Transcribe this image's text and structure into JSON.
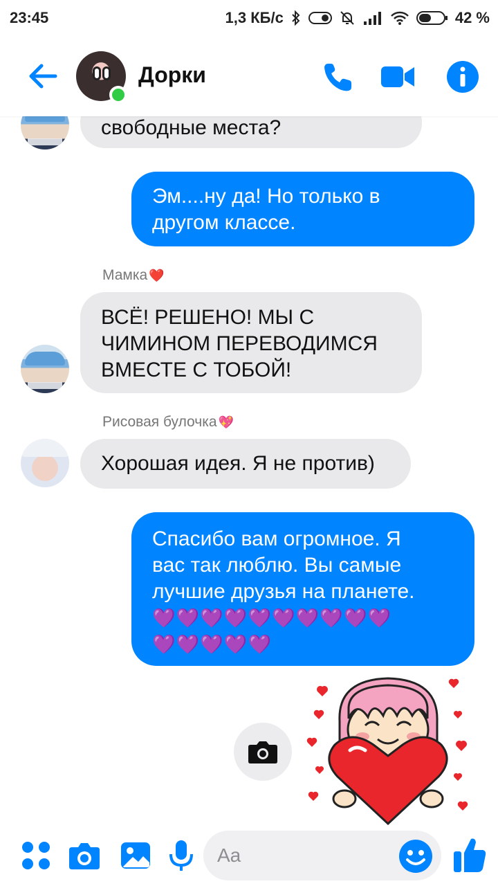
{
  "status": {
    "time": "23:45",
    "network_speed": "1,3 КБ/с",
    "battery": "42 %"
  },
  "header": {
    "contact_name": "Дорки"
  },
  "messages": [
    {
      "side": "in",
      "text": "свободные места?"
    },
    {
      "side": "out",
      "lines": [
        "Эм....ну да! Но только в",
        "другом классе."
      ]
    },
    {
      "sender": "Мамка",
      "sender_emoji": "❤️",
      "side": "in",
      "lines": [
        "ВСЁ! РЕШЕНО! МЫ С",
        "ЧИМИНОМ ПЕРЕВОДИМСЯ",
        "ВМЕСТЕ С ТОБОЙ!"
      ]
    },
    {
      "sender": "Рисовая булочка",
      "sender_emoji": "💖",
      "side": "in",
      "text": "Хорошая идея. Я не против)"
    },
    {
      "side": "out",
      "lines": [
        "Спасибо вам огромное. Я",
        "вас так люблю. Вы самые",
        "лучшие друзья на планете."
      ],
      "emoji_line_1": "💜💜💜💜💜💜💜💜💜💜",
      "emoji_line_2": "💜💜💜💜💜"
    }
  ],
  "composer": {
    "placeholder": "Aa"
  },
  "colors": {
    "accent": "#0084ff",
    "incoming_bubble": "#e9e9eb",
    "online": "#31cc46"
  }
}
